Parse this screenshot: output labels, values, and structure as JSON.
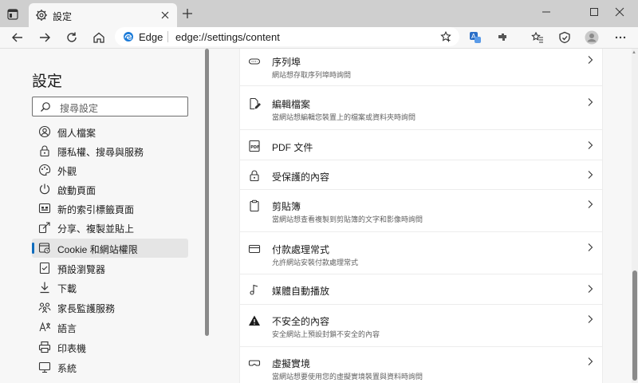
{
  "tab": {
    "title": "設定"
  },
  "address": {
    "site_label": "Edge",
    "url": "edge://settings/content"
  },
  "sidebar": {
    "title": "設定",
    "search_placeholder": "搜尋設定",
    "items": [
      {
        "label": "個人檔案",
        "icon": "profile-icon"
      },
      {
        "label": "隱私權、搜尋與服務",
        "icon": "lock-icon"
      },
      {
        "label": "外觀",
        "icon": "appearance-icon"
      },
      {
        "label": "啟動頁面",
        "icon": "power-icon"
      },
      {
        "label": "新的索引標籤頁面",
        "icon": "newtab-page-icon"
      },
      {
        "label": "分享、複製並貼上",
        "icon": "share-icon"
      },
      {
        "label": "Cookie 和網站權限",
        "icon": "site-permissions-icon",
        "active": true
      },
      {
        "label": "預設瀏覽器",
        "icon": "default-browser-icon"
      },
      {
        "label": "下載",
        "icon": "download-icon"
      },
      {
        "label": "家長監護服務",
        "icon": "family-icon"
      },
      {
        "label": "語言",
        "icon": "language-icon"
      },
      {
        "label": "印表機",
        "icon": "printer-icon"
      },
      {
        "label": "系統",
        "icon": "system-icon"
      }
    ]
  },
  "content": {
    "rows": [
      {
        "title": "序列埠",
        "desc": "網站想存取序列埠時詢問",
        "icon": "serial-port-icon"
      },
      {
        "title": "編輯檔案",
        "desc": "當網站想編輯您裝置上的檔案或資料夾時詢問",
        "icon": "file-edit-icon"
      },
      {
        "title": "PDF 文件",
        "desc": "",
        "icon": "pdf-icon"
      },
      {
        "title": "受保護的內容",
        "desc": "",
        "icon": "protected-content-icon"
      },
      {
        "title": "剪貼簿",
        "desc": "當網站想查看複製到剪貼簿的文字和影像時詢問",
        "icon": "clipboard-icon"
      },
      {
        "title": "付款處理常式",
        "desc": "允許網站安裝付款處理常式",
        "icon": "payment-icon"
      },
      {
        "title": "媒體自動播放",
        "desc": "",
        "icon": "media-autoplay-icon"
      },
      {
        "title": "不安全的內容",
        "desc": "安全網站上預設封鎖不安全的內容",
        "icon": "warning-icon"
      },
      {
        "title": "虛擬實境",
        "desc": "當網站想要使用您的虛擬實境裝置與資料時詢問",
        "icon": "vr-icon"
      }
    ]
  },
  "colors": {
    "accent": "#0f6cbd",
    "tabbar": "#cfcfcf",
    "page": "#f7f7f7",
    "card": "#ffffff"
  }
}
